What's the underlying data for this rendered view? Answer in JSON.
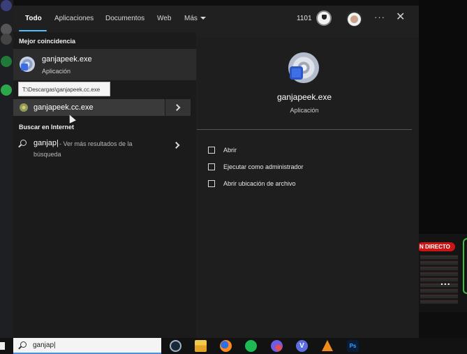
{
  "tabs": [
    {
      "label": "Todo",
      "active": true
    },
    {
      "label": "Aplicaciones"
    },
    {
      "label": "Documentos"
    },
    {
      "label": "Web"
    },
    {
      "label": "Más"
    }
  ],
  "header": {
    "points": "1101"
  },
  "left": {
    "best_match_label": "Mejor coincidencia",
    "best_match": {
      "title": "ganjapeek.exe",
      "subtitle": "Aplicación"
    },
    "tooltip": "T:\\Descargas\\ganjapeek.cc.exe",
    "result": {
      "label": "ganjapeek.cc.exe"
    },
    "web_label": "Buscar en Internet",
    "web_result": {
      "query": "ganjap|",
      "hint": "- Ver más resultados de la",
      "hint2": "búsqueda"
    }
  },
  "preview": {
    "name": "ganjapeek.exe",
    "type": "Aplicación",
    "actions": [
      {
        "label": "Abrir",
        "icon": "open-icon"
      },
      {
        "label": "Ejecutar como administrador",
        "icon": "run-as-admin-icon"
      },
      {
        "label": "Abrir ubicación de archivo",
        "icon": "folder-location-icon"
      }
    ]
  },
  "background": {
    "live_badge": "N DIRECTO",
    "more": "..."
  },
  "taskbar": {
    "search_value": "ganjap|",
    "apps": [
      "steam-icon",
      "file-explorer-icon",
      "firefox-icon",
      "spotify-icon",
      "discord-icon",
      "vpn-icon",
      "vlc-icon",
      "photoshop-icon"
    ],
    "photoshop_label": "Ps",
    "vpn_label": "V"
  }
}
